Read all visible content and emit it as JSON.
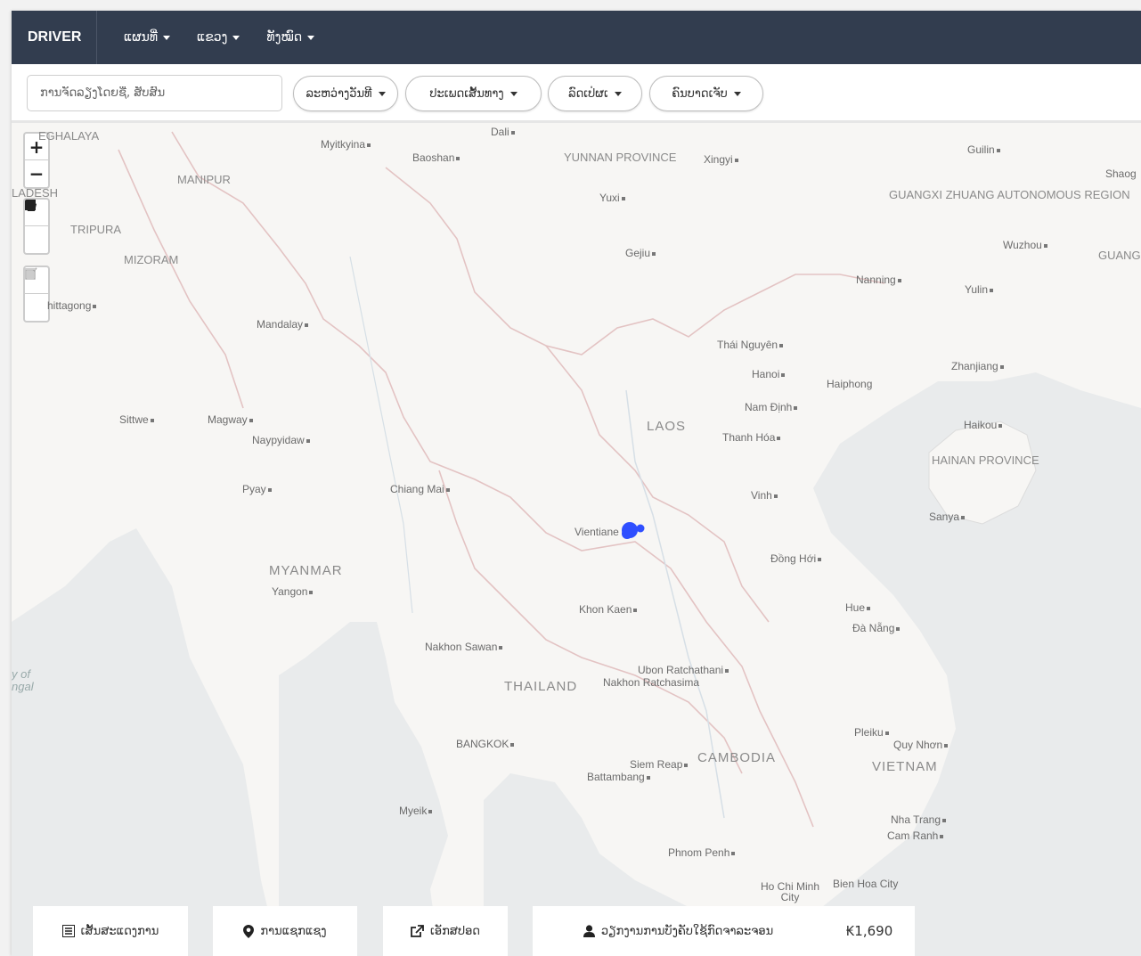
{
  "navbar": {
    "brand": "DRIVER",
    "items": [
      {
        "label": "ແຜນທີ່"
      },
      {
        "label": "ແຂວງ"
      },
      {
        "label": "ທັງໝົດ"
      }
    ]
  },
  "filters": {
    "search_placeholder": "ການຈັດລຽງໂດຍຊື່, ສັບສົນ",
    "pills": [
      {
        "label": "ລະຫວ່າງວັນທີ"
      },
      {
        "label": "ປະເພດເສັ້ນທາງ"
      },
      {
        "label": "ລົດເປ່ຜເ"
      },
      {
        "label": "ຄົນບາດເຈັບ"
      }
    ]
  },
  "map": {
    "zoom_in": "+",
    "zoom_out": "−",
    "labels": {
      "countries": [
        "MYANMAR",
        "LAOS",
        "THAILAND",
        "CAMBODIA",
        "VIETNAM"
      ],
      "regions": [
        "MANIPUR",
        "TRIPURA",
        "MIZORAM",
        "EGHALAYA",
        "LADESH",
        "YUNNAN PROVINCE",
        "GUANGXI ZHUANG AUTONOMOUS REGION",
        "HAINAN PROVINCE",
        "GUANG PROV"
      ],
      "cities": [
        "Myitkyina",
        "Baoshan",
        "Dali",
        "Xingyi",
        "Guilin",
        "Shaog",
        "Yuxi",
        "Gejiu",
        "Wuzhou",
        "Nanning",
        "Yulin",
        "hittagong",
        "Mandalay",
        "Thái Nguyên",
        "Hanoi",
        "Haiphong",
        "Zhanjiang",
        "Nam Định",
        "Thanh Hóa",
        "Haikou",
        "Sittwe",
        "Magway",
        "Naypyidaw",
        "Pyay",
        "Chiang Mai",
        "Vinh",
        "Sanya",
        "Vientiane",
        "Đồng Hới",
        "Yangon",
        "Khon Kaen",
        "Hue",
        "Đà Nẵng",
        "Nakhon Sawan",
        "Ubon Ratchathani",
        "Nakhon Ratchasima",
        "Pleiku",
        "Quy Nhơn",
        "BANGKOK",
        "Siem Reap",
        "Battambang",
        "Myeik",
        "Nha Trang",
        "Cam Ranh",
        "Phnom Penh",
        "Ho Chi Minh City",
        "Bien Hoa City"
      ],
      "sea": "y of ngal"
    }
  },
  "bottombar": {
    "items": [
      {
        "label": "ເສັ້ນສະແດງການ",
        "icon": "list-icon"
      },
      {
        "label": "ການແຊກແຊງ",
        "icon": "map-marker-icon"
      },
      {
        "label": "ເອັກສປອດ",
        "icon": "export-icon"
      },
      {
        "label": "ວຽກງານການບັງຄັບໃຊ້ກົດຈາລະຈອນ",
        "icon": "user-icon"
      }
    ],
    "price": "₭1,690"
  },
  "colors": {
    "navbar": "#323d4f",
    "marker": "#2f4fff"
  }
}
